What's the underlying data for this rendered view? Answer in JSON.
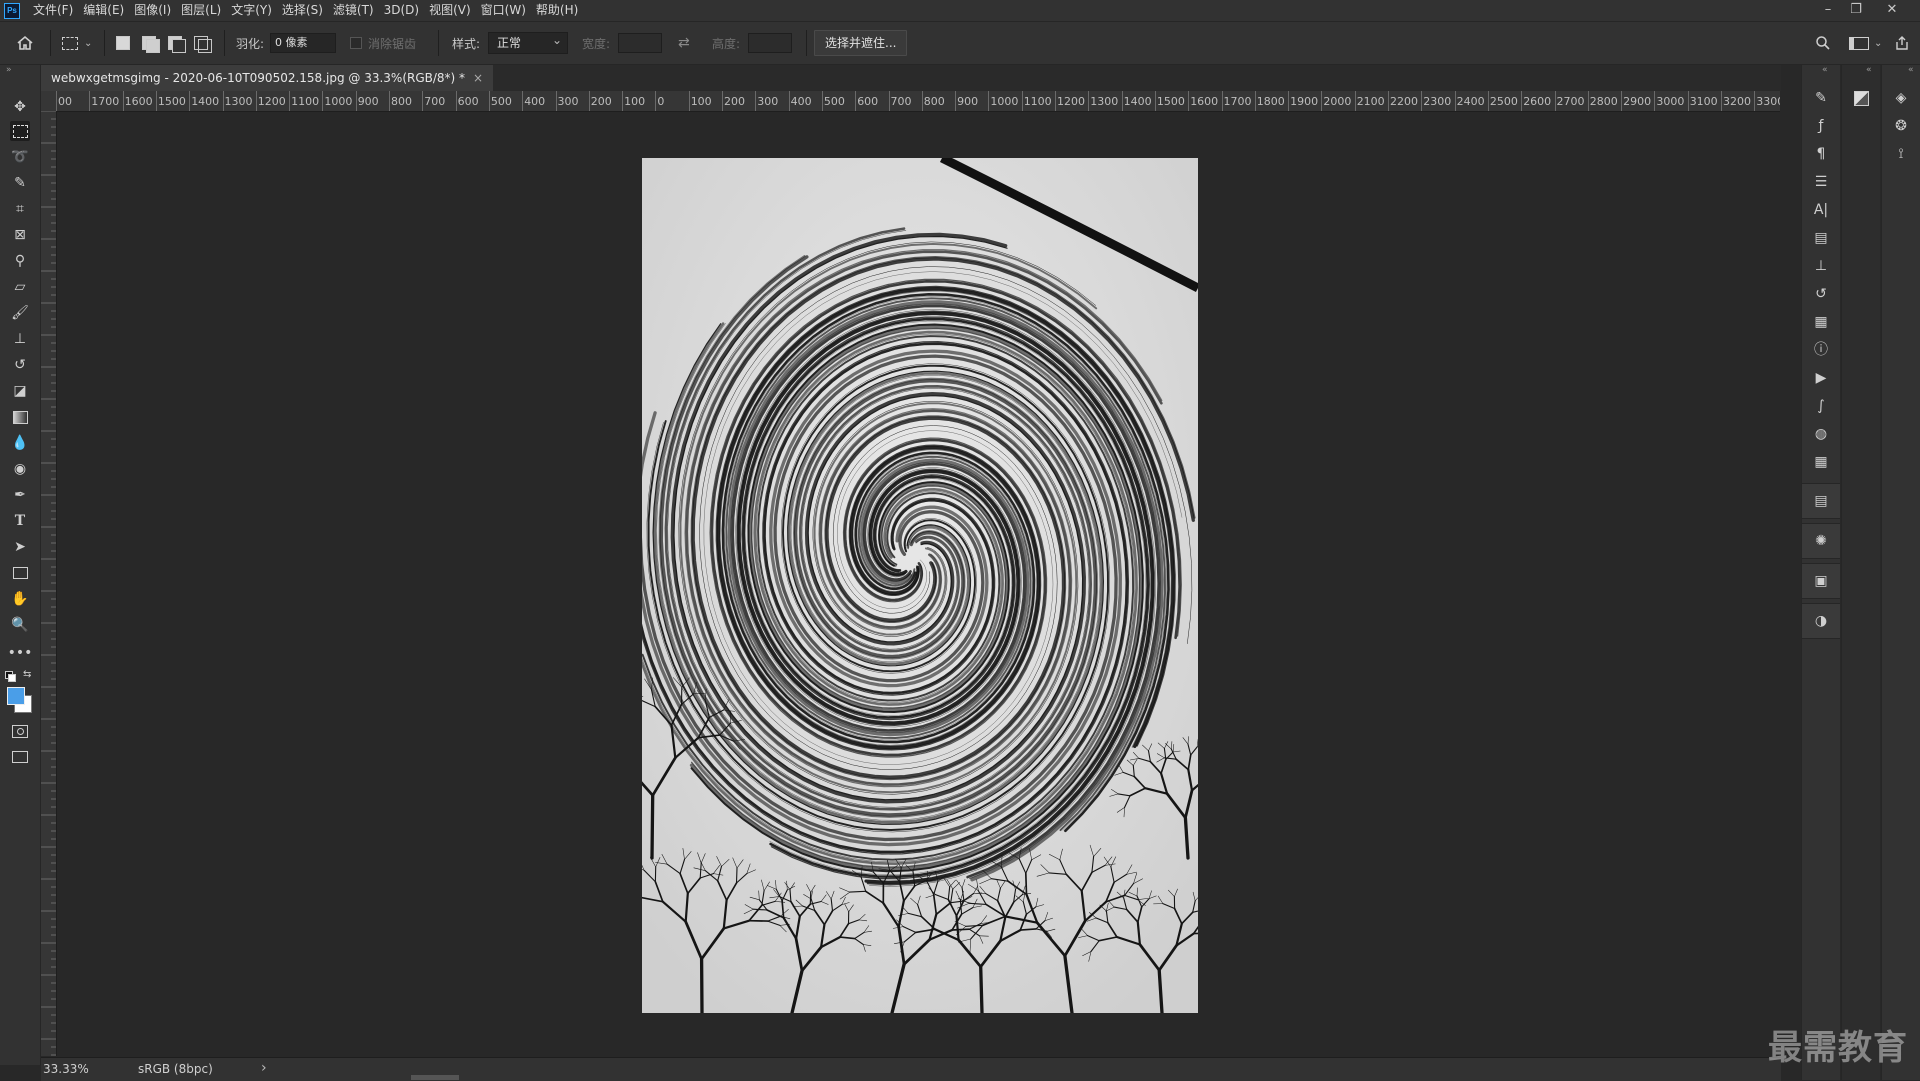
{
  "menubar": {
    "logo": "Ps",
    "items": [
      "文件(F)",
      "编辑(E)",
      "图像(I)",
      "图层(L)",
      "文字(Y)",
      "选择(S)",
      "滤镜(T)",
      "3D(D)",
      "视图(V)",
      "窗口(W)",
      "帮助(H)"
    ],
    "window_controls": {
      "minimize": "–",
      "restore": "❐",
      "close": "✕"
    }
  },
  "options": {
    "feather_label": "羽化:",
    "feather_value": "0 像素",
    "antialias_label": "消除锯齿",
    "style_label": "样式:",
    "style_value": "正常",
    "width_label": "宽度:",
    "height_label": "高度:",
    "select_mask_button": "选择并遮住..."
  },
  "document": {
    "tab_title": "webwxgetmsgimg - 2020-06-10T090502.158.jpg @ 33.3%(RGB/8*) *",
    "close": "×"
  },
  "ruler": {
    "h_labels": [
      "00",
      "1700",
      "1600",
      "1500",
      "1400",
      "1300",
      "1200",
      "1100",
      "1000",
      "900",
      "800",
      "700",
      "600",
      "500",
      "400",
      "300",
      "200",
      "100",
      "0",
      "100",
      "200",
      "300",
      "400",
      "500",
      "600",
      "700",
      "800",
      "900",
      "1000",
      "1100",
      "1200",
      "1300",
      "1400",
      "1500",
      "1600",
      "1700",
      "1800",
      "1900",
      "2000",
      "2100",
      "2200",
      "2300",
      "2400",
      "2500",
      "2600",
      "2700",
      "2800",
      "2900",
      "3000",
      "3100",
      "3200",
      "3300"
    ]
  },
  "status": {
    "zoom": "33.33%",
    "profile": "sRGB (8bpc)",
    "arrow": "›"
  },
  "watermark": "最需教育",
  "colors": {
    "foreground": "#4a9ee8",
    "background": "#ffffff",
    "accent": "#31a8ff"
  }
}
